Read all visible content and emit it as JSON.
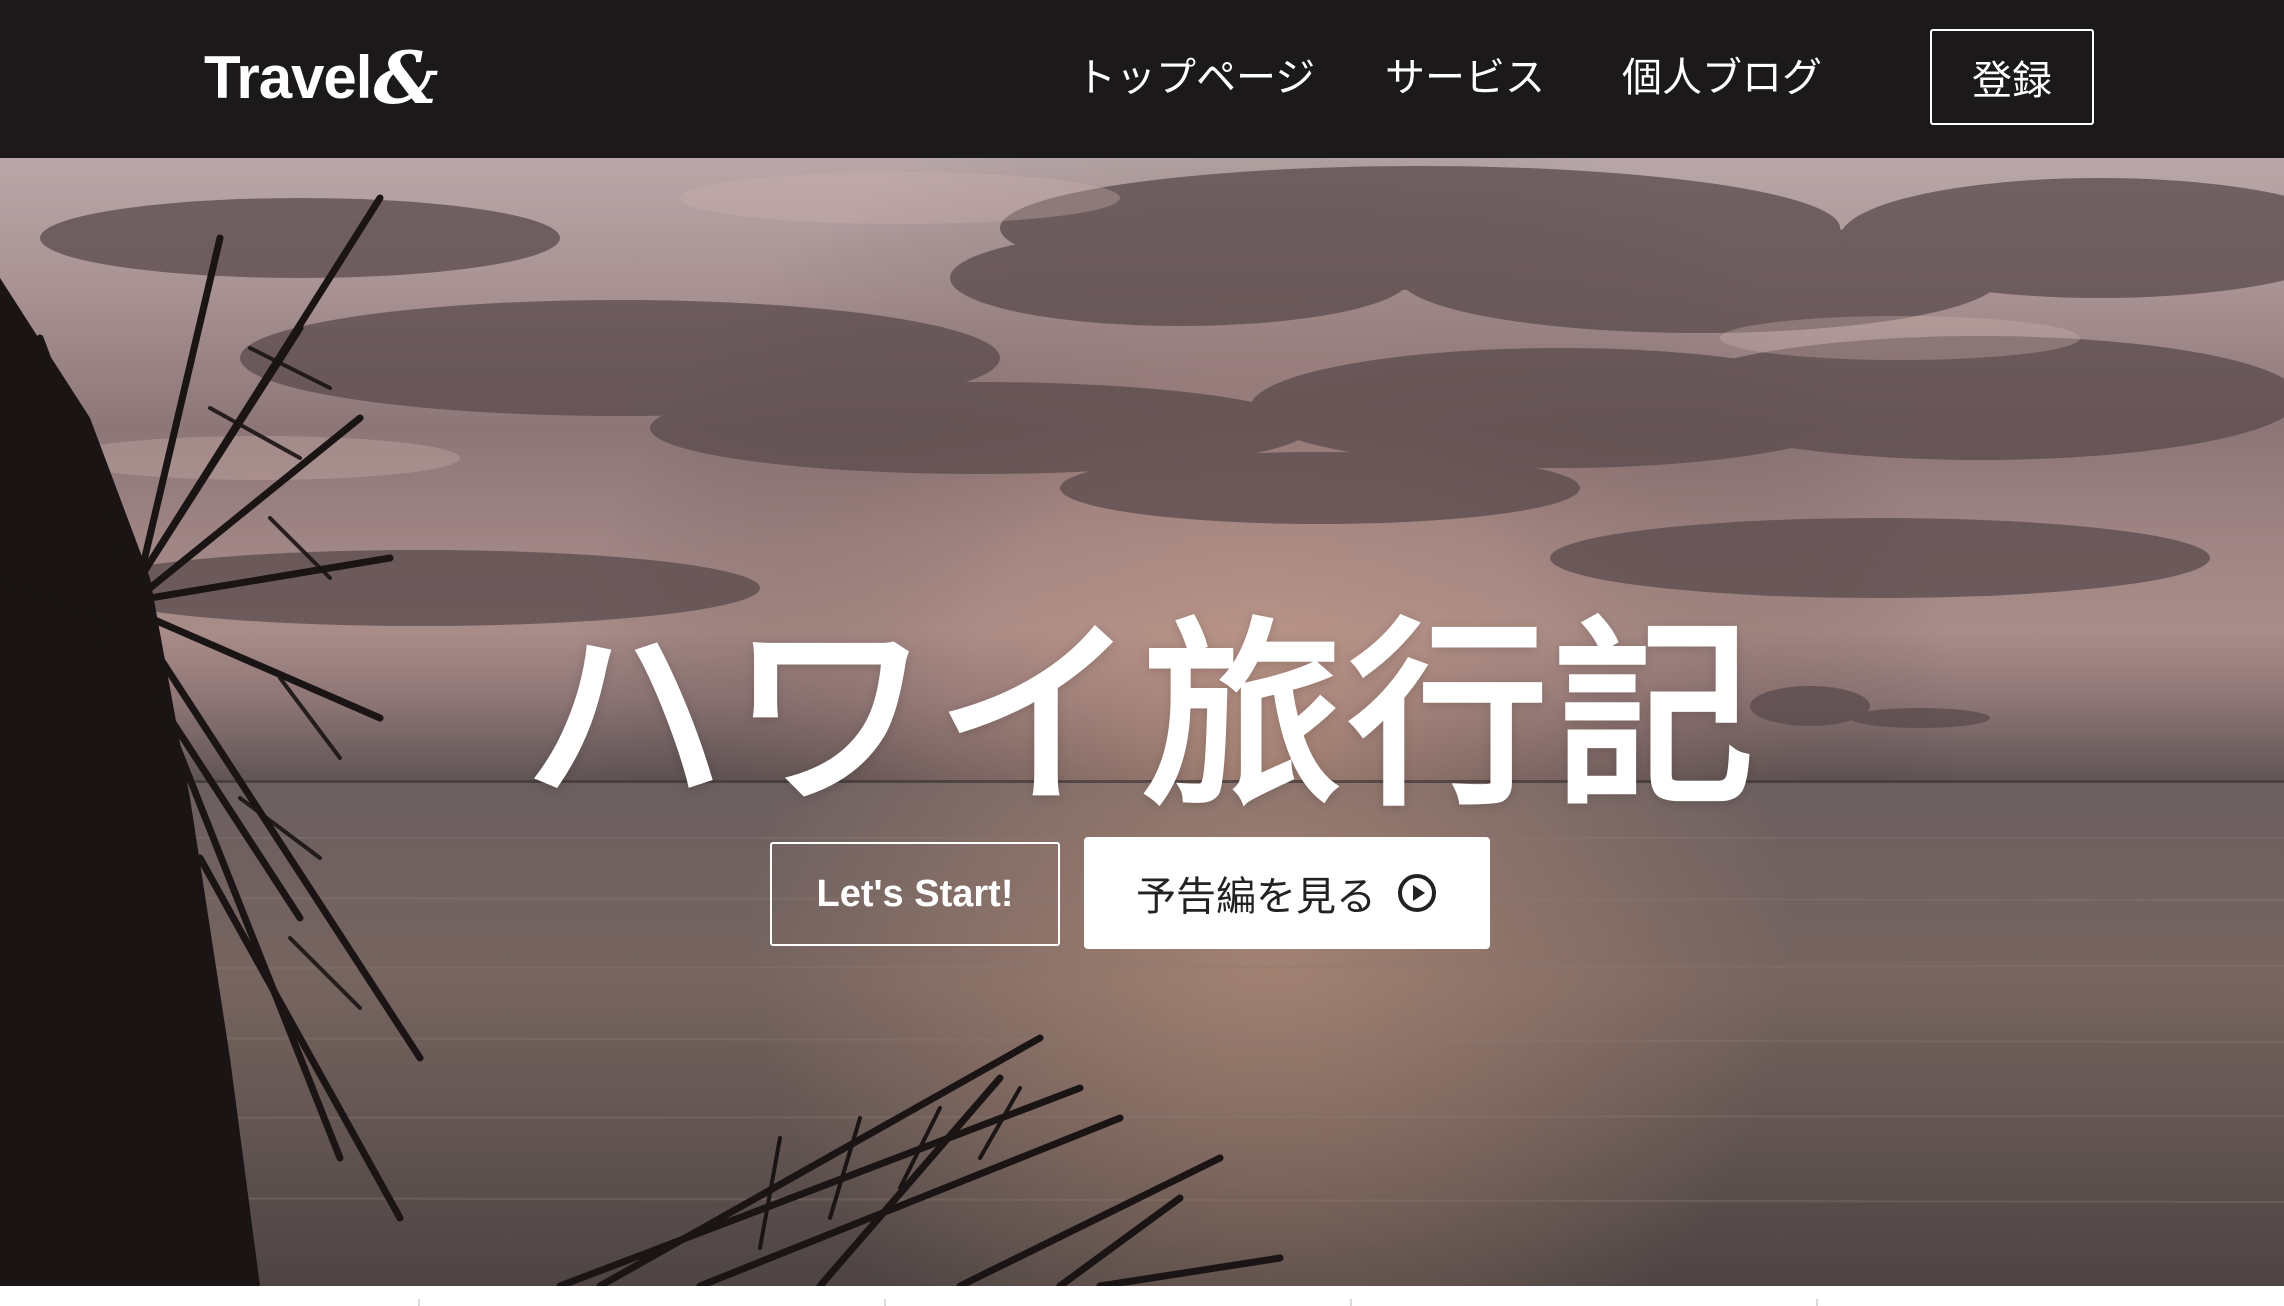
{
  "header": {
    "logo_text": "Travel",
    "logo_amp": "&",
    "nav_items": [
      {
        "label": "トップページ"
      },
      {
        "label": "サービス"
      },
      {
        "label": "個人ブログ"
      }
    ],
    "register_label": "登録"
  },
  "hero": {
    "title": "ハワイ旅行記",
    "start_label": "Let's Start!",
    "trailer_label": "予告編を見る"
  },
  "colors": {
    "header_bg": "#1b191a",
    "text": "#ffffff",
    "button_bg": "#ffffff"
  },
  "icons": {
    "trailer": "play-circle-icon"
  }
}
